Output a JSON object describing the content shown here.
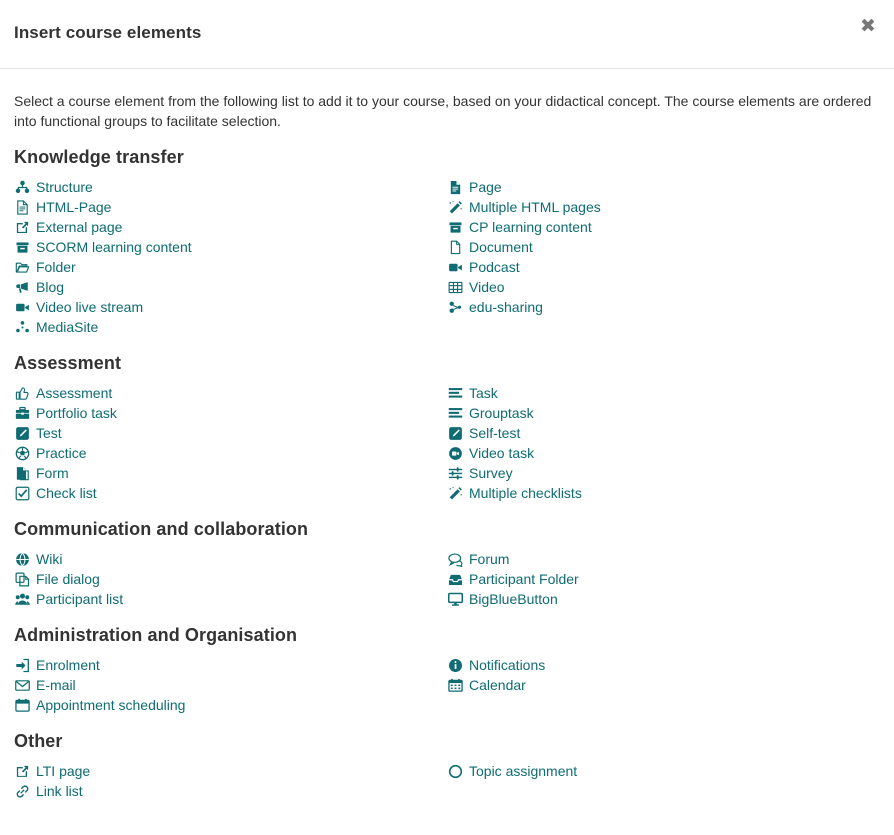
{
  "modal": {
    "title": "Insert course elements",
    "close_label": "✖",
    "intro": "Select a course element from the following list to add it to your course, based on your didactical concept. The course elements are ordered into functional groups to facilitate selection."
  },
  "colors": {
    "link": "#0f6c72",
    "text": "#333333",
    "close": "#777777",
    "divider": "#e5e5e5",
    "background": "#ffffff"
  },
  "groups": [
    {
      "title": "Knowledge transfer",
      "left": [
        {
          "label": "Structure",
          "icon": "structure-icon"
        },
        {
          "label": "HTML-Page",
          "icon": "html-page-icon"
        },
        {
          "label": "External page",
          "icon": "external-link-icon"
        },
        {
          "label": "SCORM learning content",
          "icon": "archive-icon"
        },
        {
          "label": "Folder",
          "icon": "folder-open-icon"
        },
        {
          "label": "Blog",
          "icon": "bullhorn-icon"
        },
        {
          "label": "Video live stream",
          "icon": "video-camera-icon"
        },
        {
          "label": "MediaSite",
          "icon": "mediasite-icon"
        }
      ],
      "right": [
        {
          "label": "Page",
          "icon": "page-icon"
        },
        {
          "label": "Multiple HTML pages",
          "icon": "magic-wand-icon"
        },
        {
          "label": "CP learning content",
          "icon": "archive-icon"
        },
        {
          "label": "Document",
          "icon": "document-icon"
        },
        {
          "label": "Podcast",
          "icon": "video-camera-icon"
        },
        {
          "label": "Video",
          "icon": "film-icon"
        },
        {
          "label": "edu-sharing",
          "icon": "share-nodes-icon"
        }
      ]
    },
    {
      "title": "Assessment",
      "left": [
        {
          "label": "Assessment",
          "icon": "thumbs-up-icon"
        },
        {
          "label": "Portfolio task",
          "icon": "briefcase-icon"
        },
        {
          "label": "Test",
          "icon": "pencil-square-icon"
        },
        {
          "label": "Practice",
          "icon": "soccer-ball-icon"
        },
        {
          "label": "Form",
          "icon": "form-icon"
        },
        {
          "label": "Check list",
          "icon": "check-square-icon"
        }
      ],
      "right": [
        {
          "label": "Task",
          "icon": "task-lines-icon"
        },
        {
          "label": "Grouptask",
          "icon": "task-lines-icon"
        },
        {
          "label": "Self-test",
          "icon": "pencil-square-icon"
        },
        {
          "label": "Video task",
          "icon": "video-circle-icon"
        },
        {
          "label": "Survey",
          "icon": "sliders-icon"
        },
        {
          "label": "Multiple checklists",
          "icon": "magic-wand-icon"
        }
      ]
    },
    {
      "title": "Communication and collaboration",
      "left": [
        {
          "label": "Wiki",
          "icon": "globe-icon"
        },
        {
          "label": "File dialog",
          "icon": "copy-files-icon"
        },
        {
          "label": "Participant list",
          "icon": "users-icon"
        }
      ],
      "right": [
        {
          "label": "Forum",
          "icon": "comments-icon"
        },
        {
          "label": "Participant Folder",
          "icon": "inbox-icon"
        },
        {
          "label": "BigBlueButton",
          "icon": "desktop-icon"
        }
      ]
    },
    {
      "title": "Administration and Organisation",
      "left": [
        {
          "label": "Enrolment",
          "icon": "sign-in-icon"
        },
        {
          "label": "E-mail",
          "icon": "envelope-icon"
        },
        {
          "label": "Appointment scheduling",
          "icon": "calendar-day-icon"
        }
      ],
      "right": [
        {
          "label": "Notifications",
          "icon": "info-circle-icon"
        },
        {
          "label": "Calendar",
          "icon": "calendar-icon"
        }
      ]
    },
    {
      "title": "Other",
      "left": [
        {
          "label": "LTI page",
          "icon": "external-link-icon"
        },
        {
          "label": "Link list",
          "icon": "link-icon"
        }
      ],
      "right": [
        {
          "label": "Topic assignment",
          "icon": "circle-icon"
        }
      ]
    }
  ]
}
